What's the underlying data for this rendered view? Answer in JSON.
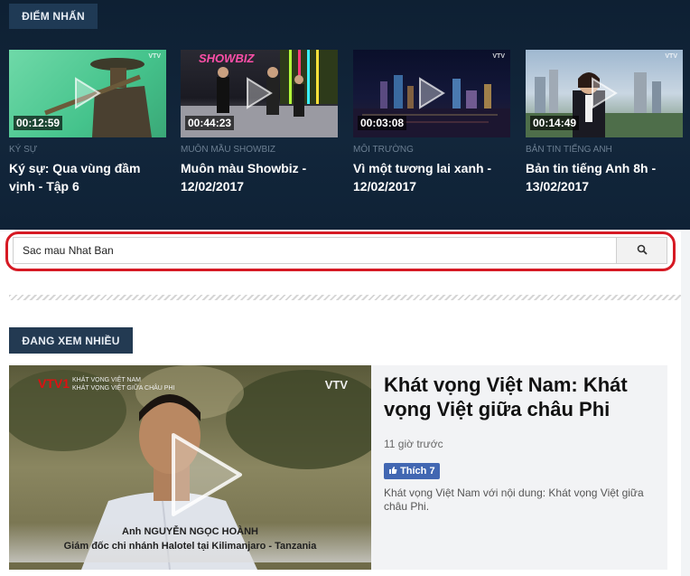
{
  "highlight_section": {
    "label": "ĐIỂM NHẤN",
    "items": [
      {
        "category": "KÝ SỰ",
        "title": "Ký sự: Qua vùng đầm vịnh - Tập 6",
        "duration": "00:12:59"
      },
      {
        "category": "MUÔN MẦU SHOWBIZ",
        "title": "Muôn màu Showbiz - 12/02/2017",
        "duration": "00:44:23",
        "overlay": "SHOWBIZ"
      },
      {
        "category": "MÔI TRƯỜNG",
        "title": "Vì một tương lai xanh - 12/02/2017",
        "duration": "00:03:08"
      },
      {
        "category": "BẢN TIN TIẾNG ANH",
        "title": "Bản tin tiếng Anh 8h - 13/02/2017",
        "duration": "00:14:49"
      }
    ]
  },
  "search": {
    "value": "Sac mau Nhat Ban",
    "icon": "search-icon"
  },
  "most_viewed": {
    "label": "ĐANG XEM NHIỀU",
    "feature": {
      "title": "Khát vọng Việt Nam: Khát vọng Việt giữa châu Phi",
      "time": "11 giờ trước",
      "like_label": "Thích 7",
      "description": "Khát vọng Việt Nam với nội dung: Khát vọng Việt giữa châu Phi.",
      "video_caption_name": "Anh NGUYỄN NGỌC HOÀNH",
      "video_caption_role": "Giám đốc chi nhánh Halotel tại Kilimanjaro - Tanzania"
    }
  },
  "colors": {
    "header_bg": "#12263b",
    "button_bg": "#1f3a55",
    "highlight_ring": "#d61a24",
    "like_blue": "#4267b2"
  }
}
